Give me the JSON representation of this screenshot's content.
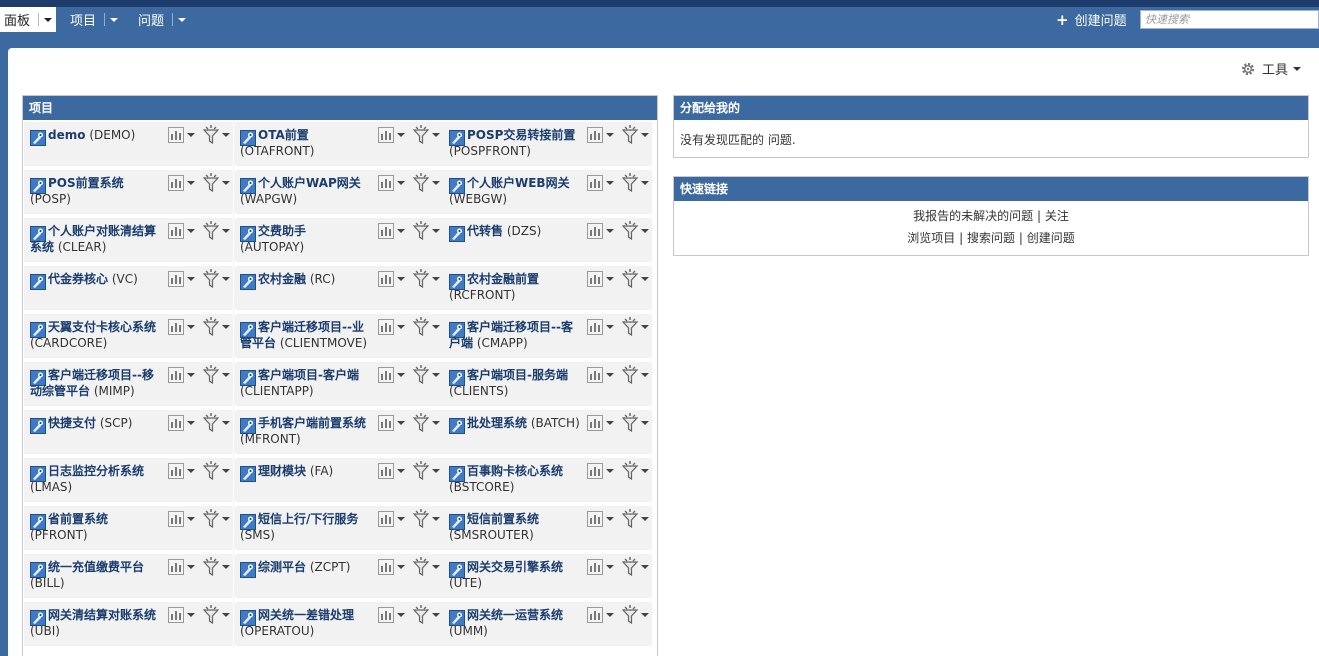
{
  "nav": {
    "tabs": [
      {
        "label": "面板"
      },
      {
        "label": "项目"
      },
      {
        "label": "问题"
      }
    ],
    "create_label": "创建问题",
    "search_placeholder": "快速搜索"
  },
  "tools_label": "工具",
  "projects_panel": {
    "title": "项目",
    "projects": [
      {
        "name": "demo",
        "key": "(DEMO)"
      },
      {
        "name": "OTA前置",
        "key": "(OTAFRONT)"
      },
      {
        "name": "POSP交易转接前置",
        "key": "(POSPFRONT)"
      },
      {
        "name": "POS前置系统",
        "key": "(POSP)"
      },
      {
        "name": "个人账户WAP网关",
        "key": "(WAPGW)"
      },
      {
        "name": "个人账户WEB网关",
        "key": "(WEBGW)"
      },
      {
        "name": "个人账户对账清结算系统",
        "key": "(CLEAR)"
      },
      {
        "name": "交费助手",
        "key": "(AUTOPAY)"
      },
      {
        "name": "代转售",
        "key": "(DZS)"
      },
      {
        "name": "代金券核心",
        "key": "(VC)"
      },
      {
        "name": "农村金融",
        "key": "(RC)"
      },
      {
        "name": "农村金融前置",
        "key": "(RCFRONT)"
      },
      {
        "name": "天翼支付卡核心系统",
        "key": "(CARDCORE)"
      },
      {
        "name": "客户端迁移项目--业管平台",
        "key": "(CLIENTMOVE)"
      },
      {
        "name": "客户端迁移项目--客户端",
        "key": "(CMAPP)"
      },
      {
        "name": "客户端迁移项目--移动综管平台",
        "key": "(MIMP)"
      },
      {
        "name": "客户端项目-客户端",
        "key": "(CLIENTAPP)"
      },
      {
        "name": "客户端项目-服务端",
        "key": "(CLIENTS)"
      },
      {
        "name": "快捷支付",
        "key": "(SCP)"
      },
      {
        "name": "手机客户端前置系统",
        "key": "(MFRONT)"
      },
      {
        "name": "批处理系统",
        "key": "(BATCH)"
      },
      {
        "name": "日志监控分析系统",
        "key": "(LMAS)"
      },
      {
        "name": "理财模块",
        "key": "(FA)"
      },
      {
        "name": "百事购卡核心系统",
        "key": "(BSTCORE)"
      },
      {
        "name": "省前置系统",
        "key": "(PFRONT)"
      },
      {
        "name": "短信上行/下行服务",
        "key": "(SMS)"
      },
      {
        "name": "短信前置系统",
        "key": "(SMSROUTER)"
      },
      {
        "name": "统一充值缴费平台",
        "key": "(BILL)"
      },
      {
        "name": "综测平台",
        "key": "(ZCPT)"
      },
      {
        "name": "网关交易引擎系统",
        "key": "(UTE)"
      },
      {
        "name": "网关清结算对账系统",
        "key": "(UBI)"
      },
      {
        "name": "网关统一差错处理",
        "key": "(OPERATOU)"
      },
      {
        "name": "网关统一运营系统",
        "key": "(UMM)"
      }
    ]
  },
  "assigned_panel": {
    "title": "分配给我的",
    "empty_text": "没有发现匹配的",
    "empty_link": "问题",
    "empty_suffix": "."
  },
  "quick_links": {
    "title": "快速链接",
    "row1": [
      "我报告的未解决的问题",
      "关注"
    ],
    "row2": [
      "浏览项目",
      "搜索问题",
      "创建问题"
    ],
    "sep": "|"
  },
  "colors": {
    "nav_bg": "#3c69a0",
    "top_strip": "#1e3c6b",
    "link": "#1a3d6e"
  }
}
